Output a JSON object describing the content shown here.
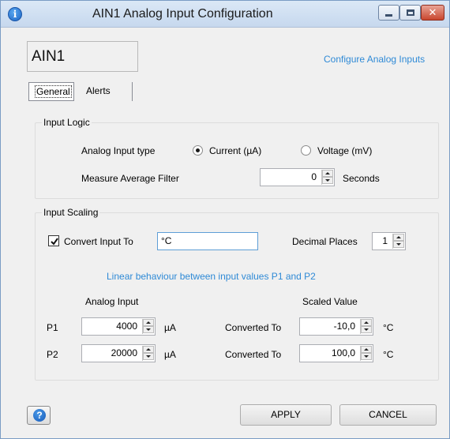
{
  "window": {
    "title": "AIN1 Analog Input Configuration",
    "title_icon": "info-icon",
    "controls": [
      "minimize",
      "maximize",
      "close"
    ],
    "close_glyph": "✕",
    "accent_color": "#2f8ad6"
  },
  "header": {
    "name": "AIN1",
    "configure_link": "Configure Analog Inputs"
  },
  "tabs": [
    {
      "label": "General",
      "selected": true
    },
    {
      "label": "Alerts",
      "selected": false
    }
  ],
  "input_logic": {
    "legend": "Input Logic",
    "type_label": "Analog Input type",
    "options": [
      {
        "label": "Current (µA)",
        "selected": true
      },
      {
        "label": "Voltage (mV)",
        "selected": false
      }
    ],
    "filter_label": "Measure Average Filter",
    "filter_value": "0",
    "filter_unit": "Seconds"
  },
  "input_scaling": {
    "legend": "Input Scaling",
    "convert_label": "Convert Input To",
    "convert_checked": true,
    "convert_value": "°C",
    "decimal_label": "Decimal Places",
    "decimal_value": "1",
    "hint": "Linear behaviour between input values P1 and P2",
    "analog_header": "Analog Input",
    "scaled_header": "Scaled Value",
    "rows": [
      {
        "label": "P1",
        "input": "4000",
        "input_unit": "µA",
        "converted_label": "Converted To",
        "value": "-10,0",
        "value_unit": "°C"
      },
      {
        "label": "P2",
        "input": "20000",
        "input_unit": "µA",
        "converted_label": "Converted To",
        "value": "100,0",
        "value_unit": "°C"
      }
    ]
  },
  "footer": {
    "help_glyph": "?",
    "apply_label": "APPLY",
    "cancel_label": "CANCEL"
  }
}
